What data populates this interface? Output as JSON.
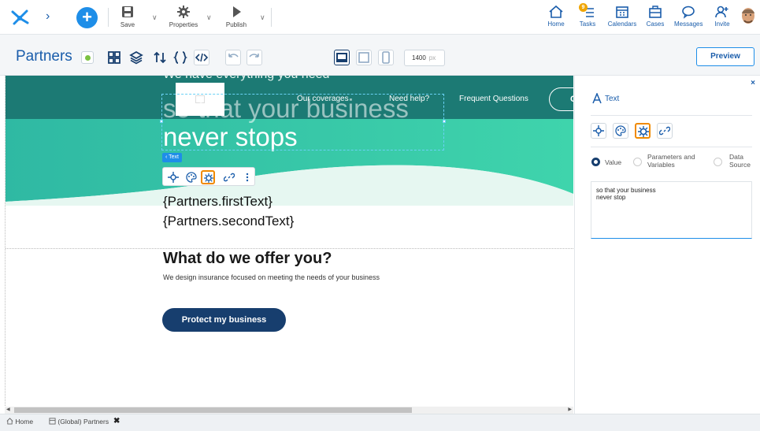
{
  "toolbar": {
    "save_label": "Save",
    "properties_label": "Properties",
    "publish_label": "Publish",
    "home_label": "Home",
    "tasks_label": "Tasks",
    "tasks_badge": "9",
    "calendars_label": "Calendars",
    "cases_label": "Cases",
    "messages_label": "Messages",
    "invite_label": "Invite"
  },
  "designer": {
    "page_title": "Partners",
    "width_value": "1400",
    "width_unit": "px",
    "preview_label": "Preview"
  },
  "canvas": {
    "hero_top_text": "We have everything you need",
    "nav_links": [
      "Our coverages",
      "Need help?",
      "Frequent Questions"
    ],
    "nav_pill_text": "C",
    "hero_line1": "so that your business",
    "hero_line2": "never stops",
    "element_tag": "‹ Text",
    "binding_first": "{Partners.firstText}",
    "binding_second": "{Partners.secondText}",
    "offer_title": "What do we offer you?",
    "offer_description": "We design insurance focused on meeting the needs of your business",
    "cta_label": "Protect my business"
  },
  "panel": {
    "close_glyph": "×",
    "title": "Text",
    "source_options": {
      "value": "Value",
      "params": "Parameters and Variables",
      "datasource": "Data Source"
    },
    "selected_source": "Value",
    "text_value": "so that your business\nnever stop"
  },
  "bottom_tabs": {
    "home_label": "Home",
    "partners_label": "(Global) Partners",
    "close_glyph": "✖"
  },
  "colors": {
    "accent_blue": "#1e8ee8",
    "brand_navy": "#173e6e",
    "hero_teal_dark": "#1c7a74",
    "hero_teal_light": "#3fd4ac",
    "active_outline": "#f08a00"
  }
}
